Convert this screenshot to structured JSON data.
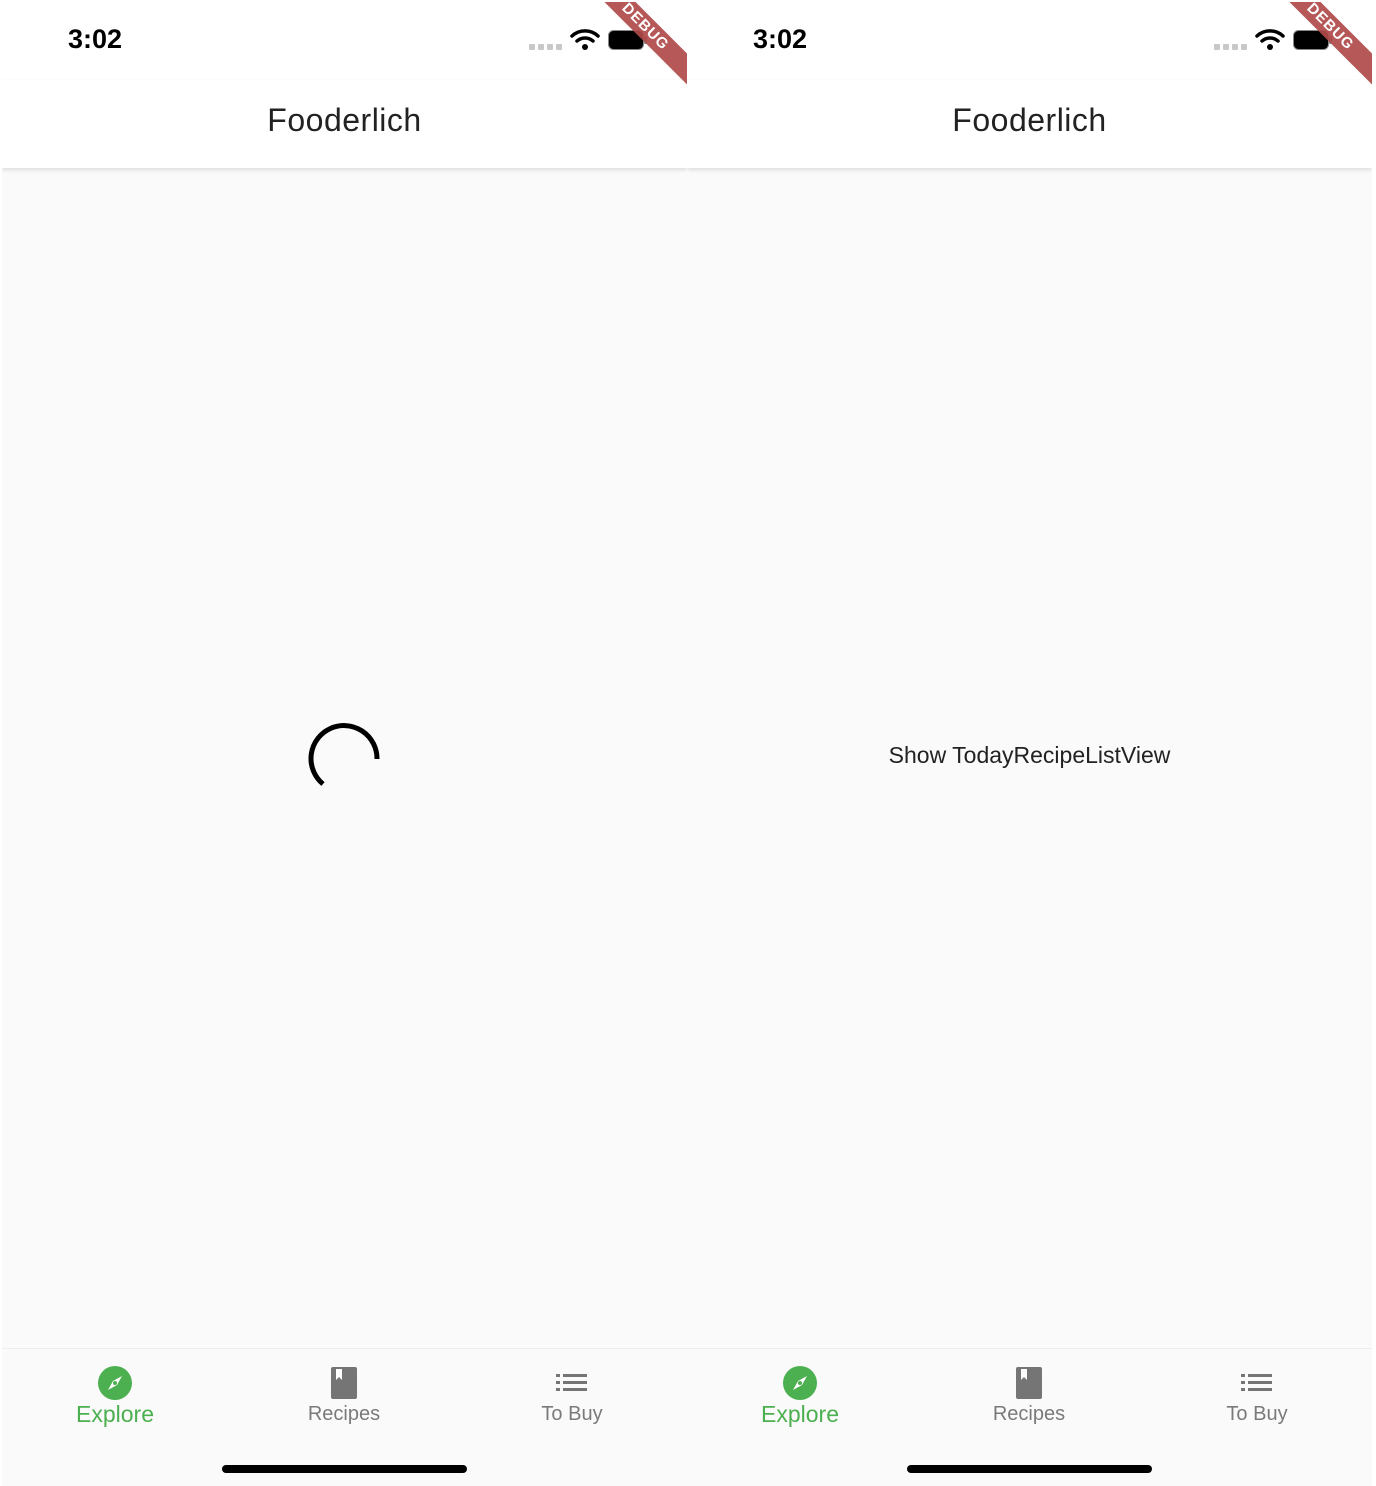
{
  "screens": [
    {
      "status": {
        "time": "3:02"
      },
      "debug_banner": "DEBUG",
      "app_bar": {
        "title": "Fooderlich"
      },
      "body": {
        "state": "loading",
        "text": ""
      },
      "nav": {
        "items": [
          {
            "label": "Explore",
            "icon": "compass-icon",
            "active": true
          },
          {
            "label": "Recipes",
            "icon": "book-icon",
            "active": false
          },
          {
            "label": "To Buy",
            "icon": "list-icon",
            "active": false
          }
        ]
      }
    },
    {
      "status": {
        "time": "3:02"
      },
      "debug_banner": "DEBUG",
      "app_bar": {
        "title": "Fooderlich"
      },
      "body": {
        "state": "loaded",
        "text": "Show TodayRecipeListView"
      },
      "nav": {
        "items": [
          {
            "label": "Explore",
            "icon": "compass-icon",
            "active": true
          },
          {
            "label": "Recipes",
            "icon": "book-icon",
            "active": false
          },
          {
            "label": "To Buy",
            "icon": "list-icon",
            "active": false
          }
        ]
      }
    }
  ],
  "colors": {
    "active": "#4caf50",
    "inactive": "#7a7a7a",
    "debug": "#b14a4a",
    "background": "#fafafa"
  }
}
